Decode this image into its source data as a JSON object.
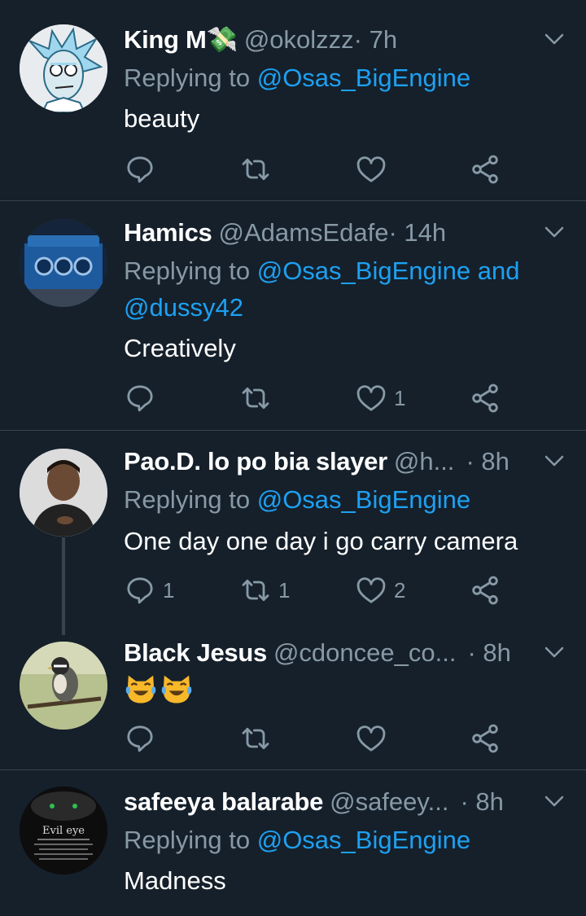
{
  "tweets": [
    {
      "name": "King M💸",
      "handle": "@okolzzz",
      "time": " · 7h",
      "replying_prefix": "Replying to ",
      "mention1": "@Osas_BigEngine",
      "mention_join": "",
      "mention2": "",
      "text": "beauty",
      "reply_count": "",
      "retweet_count": "",
      "like_count": ""
    },
    {
      "name": "Hamics",
      "handle": "@AdamsEdafe",
      "time": " · 14h",
      "replying_prefix": "Replying to ",
      "mention1": "@Osas_BigEngine",
      "mention_join": " and",
      "mention2": "@dussy42",
      "text": "Creatively",
      "reply_count": "",
      "retweet_count": "",
      "like_count": "1"
    },
    {
      "name": "Pao.D. lo po bia slayer",
      "handle": "@h...",
      "time": " · 8h",
      "replying_prefix": "Replying to ",
      "mention1": "@Osas_BigEngine",
      "mention_join": "",
      "mention2": "",
      "text": "One day one day i go carry camera",
      "reply_count": "1",
      "retweet_count": "1",
      "like_count": "2"
    },
    {
      "name": "Black Jesus",
      "handle": "@cdoncee_co...",
      "time": " · 8h",
      "text": "😹😹",
      "reply_count": "",
      "retweet_count": "",
      "like_count": ""
    },
    {
      "name": "safeeya balarabe",
      "handle": "@safeey...",
      "time": " · 8h",
      "replying_prefix": "Replying to ",
      "mention1": "@Osas_BigEngine",
      "text": "Madness",
      "avatar_text": "Evil eye"
    }
  ],
  "colors": {
    "background": "#15202b",
    "mention": "#1da1f2",
    "secondary": "#8899a6",
    "divider": "#38444d"
  },
  "icons": [
    "chevron-down-icon",
    "reply-icon",
    "retweet-icon",
    "like-icon",
    "share-icon"
  ]
}
